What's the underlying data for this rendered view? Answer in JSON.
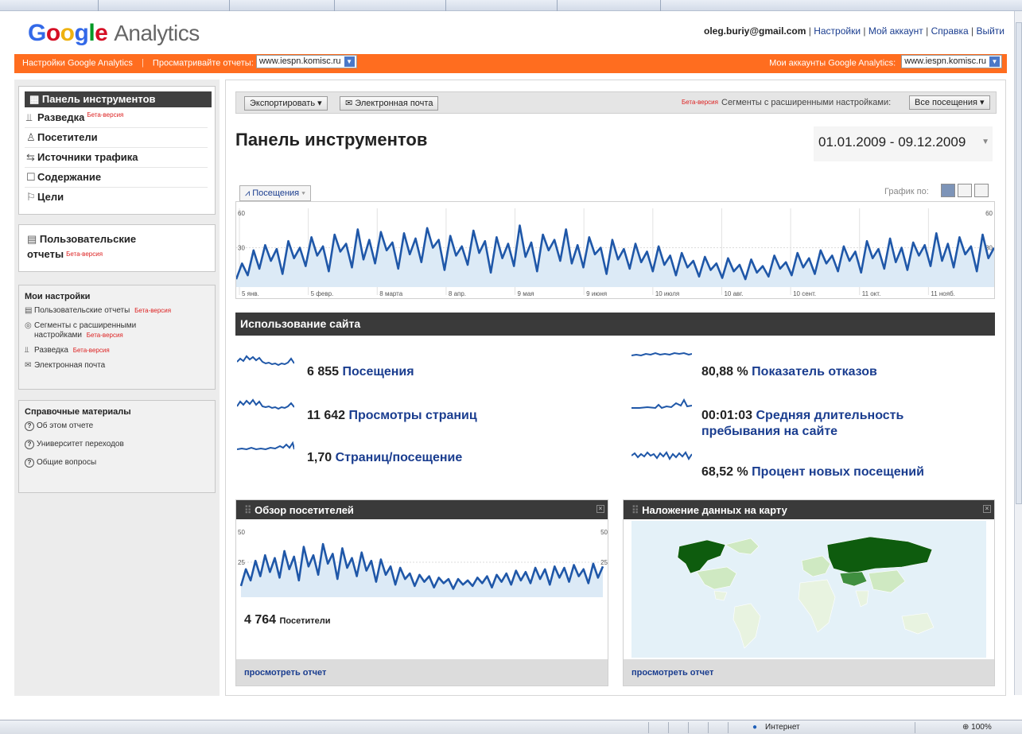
{
  "logo": {
    "g": "G",
    "o1": "o",
    "o2": "o",
    "gl": "g",
    "l": "l",
    "e": "e",
    "analytics": "Analytics"
  },
  "header": {
    "email": "oleg.buriy@gmail.com",
    "links": [
      "Настройки",
      "Мой аккаунт",
      "Справка",
      "Выйти"
    ]
  },
  "orange_bar": {
    "settings": "Настройки Google Analytics",
    "view_reports": "Просматривайте отчеты:",
    "site_select": "www.iespn.komisc.ru",
    "my_accounts": "Мои аккаунты Google Analytics:",
    "account_select": "www.iespn.komisc.ru"
  },
  "nav": {
    "selected": "Панель инструментов",
    "items": [
      {
        "label": "Разведка",
        "beta": "Бета-версия",
        "icon": "chart-icon"
      },
      {
        "label": "Посетители",
        "beta": "",
        "icon": "user-icon"
      },
      {
        "label": "Источники трафика",
        "beta": "",
        "icon": "traffic-icon"
      },
      {
        "label": "Содержание",
        "beta": "",
        "icon": "page-icon"
      },
      {
        "label": "Цели",
        "beta": "",
        "icon": "flag-icon"
      }
    ]
  },
  "custom_reports": {
    "label1": "Пользовательские",
    "label2": "отчеты",
    "beta": "Бета-версия"
  },
  "my_settings": {
    "title": "Мои настройки",
    "custom_reports": "Пользовательские отчеты",
    "segments1": "Сегменты с расширенными",
    "segments2": "настройками",
    "intel": "Разведка",
    "email": "Электронная почта",
    "beta": "Бета-версия"
  },
  "reference": {
    "title": "Справочные материалы",
    "items": [
      "Об этом отчете",
      "Университет переходов",
      "Общие вопросы"
    ]
  },
  "toolbar": {
    "export": "Экспортировать",
    "email": "Электронная почта",
    "beta": "Бета-версия",
    "segments_label": "Сегменты с расширенными настройками:",
    "segments_value": "Все посещения"
  },
  "page_title": "Панель инструментов",
  "date_range": "01.01.2009 - 09.12.2009",
  "metric_tab": "Посещения",
  "graph_by": "График по:",
  "chart_data": [
    {
      "type": "line",
      "title": "Посещения",
      "ylim": [
        0,
        60
      ],
      "y_ticks": [
        "60",
        "30"
      ],
      "y_ticks_right": [
        "60",
        "30"
      ],
      "x_ticks": [
        "5 янв.",
        "5 февр.",
        "8 марта",
        "8 апр.",
        "9 мая",
        "9 июня",
        "10 июля",
        "10 авг.",
        "10 сент.",
        "11 окт.",
        "11 нояб."
      ],
      "series": [
        {
          "values": [
            6,
            18,
            9,
            28,
            14,
            32,
            20,
            29,
            10,
            35,
            22,
            30,
            16,
            38,
            24,
            31,
            12,
            40,
            27,
            33,
            15,
            44,
            21,
            36,
            18,
            42,
            28,
            34,
            14,
            41,
            25,
            37,
            19,
            45,
            30,
            36,
            13,
            39,
            24,
            31,
            17,
            43,
            26,
            35,
            11,
            38,
            22,
            33,
            16,
            47,
            23,
            34,
            12,
            40,
            28,
            36,
            20,
            44,
            18,
            32,
            15,
            38,
            25,
            30,
            10,
            36,
            21,
            29,
            14,
            33,
            19,
            27,
            12,
            31,
            17,
            24,
            9,
            26,
            15,
            20,
            8,
            23,
            13,
            18,
            7,
            22,
            12,
            17,
            6,
            21,
            11,
            16,
            8,
            24,
            14,
            19,
            9,
            26,
            15,
            22,
            10,
            28,
            18,
            24,
            12,
            31,
            20,
            27,
            11,
            35,
            22,
            29,
            14,
            37,
            19,
            30,
            13,
            34,
            24,
            32,
            16,
            41,
            20,
            33,
            15,
            38,
            25,
            31,
            12,
            40,
            22,
            30
          ]
        }
      ]
    },
    {
      "type": "line",
      "title": "Обзор посетителей",
      "ylim": [
        0,
        50
      ],
      "y_ticks": [
        "50",
        "25"
      ],
      "y_ticks_right": [
        "50",
        "25"
      ],
      "series": [
        {
          "values": [
            8,
            20,
            12,
            26,
            15,
            30,
            18,
            28,
            14,
            33,
            20,
            29,
            12,
            36,
            22,
            30,
            16,
            38,
            24,
            31,
            13,
            35,
            21,
            28,
            15,
            32,
            19,
            26,
            11,
            27,
            16,
            22,
            9,
            21,
            13,
            17,
            8,
            16,
            11,
            15,
            7,
            14,
            10,
            13,
            6,
            13,
            9,
            12,
            8,
            14,
            10,
            15,
            7,
            16,
            11,
            17,
            9,
            19,
            12,
            18,
            10,
            21,
            13,
            20,
            9,
            22,
            14,
            21,
            11,
            23,
            15,
            20,
            10,
            24,
            14,
            22
          ]
        }
      ]
    }
  ],
  "usage": {
    "title": "Использование сайта",
    "metrics": [
      {
        "value": "6 855",
        "label": "Посещения"
      },
      {
        "value": "11 642",
        "label": "Просмотры страниц"
      },
      {
        "value": "1,70",
        "label": "Страниц/посещение"
      },
      {
        "value": "80,88 %",
        "label": "Показатель отказов"
      },
      {
        "value": "00:01:03",
        "label": "Средняя длительность",
        "label2": "пребывания на сайте"
      },
      {
        "value": "68,52 %",
        "label": "Процент новых посещений"
      }
    ]
  },
  "visitors_panel": {
    "title": "Обзор посетителей",
    "count": "4 764",
    "count_label": "Посетители",
    "footer": "просмотреть отчет"
  },
  "map_panel": {
    "title": "Наложение данных на карту",
    "footer": "просмотреть отчет"
  },
  "status": {
    "zone": "Интернет",
    "zoom": "100%"
  },
  "colors": {
    "accent_orange": "#ff6d1f",
    "line_blue": "#1f57a8",
    "dark_header": "#3a3a3a",
    "map_dark": "#0e5c0e",
    "map_mid": "#3f8f3f",
    "map_light": "#cfe9c2",
    "ocean": "#e4f1f8"
  }
}
